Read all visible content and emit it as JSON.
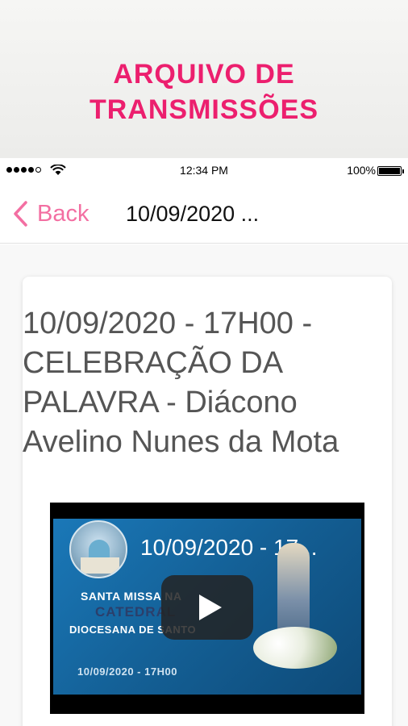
{
  "promo": {
    "title_line1": "ARQUIVO DE",
    "title_line2": "TRANSMISSÕES",
    "accent": "#ec1f6e"
  },
  "status_bar": {
    "time": "12:34 PM",
    "battery": "100%"
  },
  "navbar": {
    "back_label": "Back",
    "title": "10/09/2020 ..."
  },
  "post": {
    "title": "10/09/2020 - 17H00 - CELEBRAÇÃO DA PALAVRA - Diácono Avelino Nunes da Mota"
  },
  "video": {
    "title": "10/09/2020 - 17...",
    "line1": "SANTA MISSA NA",
    "line2": "CATEDRAL",
    "line3": "DIOCESANA DE SANTO",
    "date_time": "10/09/2020 - 17H00"
  },
  "icons": {
    "back": "chevron-left-icon",
    "play": "play-icon",
    "wifi": "wifi-icon",
    "battery": "battery-icon"
  }
}
